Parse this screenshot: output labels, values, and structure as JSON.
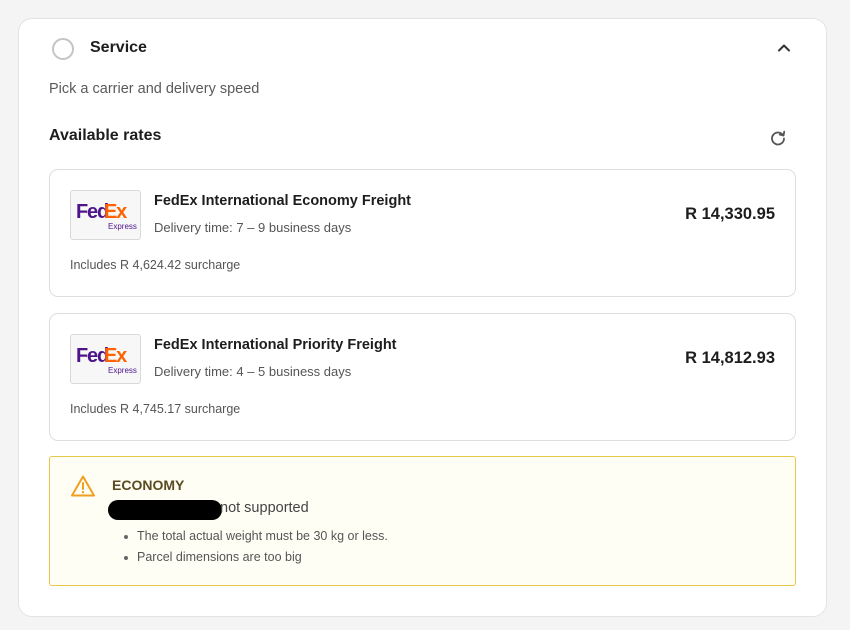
{
  "service": {
    "title": "Service",
    "subtitle": "Pick a carrier and delivery speed"
  },
  "rates": {
    "heading": "Available rates",
    "items": [
      {
        "logo_fed": "Fed",
        "logo_ex": "Ex",
        "logo_sub": "Express",
        "name": "FedEx International Economy Freight",
        "delivery": "Delivery time: 7 – 9 business days",
        "price": "R 14,330.95",
        "surcharge": "Includes R 4,624.42 surcharge"
      },
      {
        "logo_fed": "Fed",
        "logo_ex": "Ex",
        "logo_sub": "Express",
        "name": "FedEx International Priority Freight",
        "delivery": "Delivery time: 4 – 5 business days",
        "price": "R 14,812.93",
        "surcharge": "Includes R 4,745.17 surcharge"
      }
    ]
  },
  "warning": {
    "title": "ECONOMY",
    "message": "not supported",
    "reasons": [
      "The total actual weight must be 30 kg or less.",
      "Parcel dimensions are too big"
    ]
  },
  "colors": {
    "fedex_purple": "#4d148c",
    "fedex_orange": "#ff6200",
    "warning_border": "#e8c84a",
    "warning_icon": "#f0a020"
  },
  "icons": {
    "radio": "radio-empty-icon",
    "collapse": "chevron-up-icon",
    "refresh": "refresh-icon",
    "warning": "warning-triangle-icon"
  }
}
